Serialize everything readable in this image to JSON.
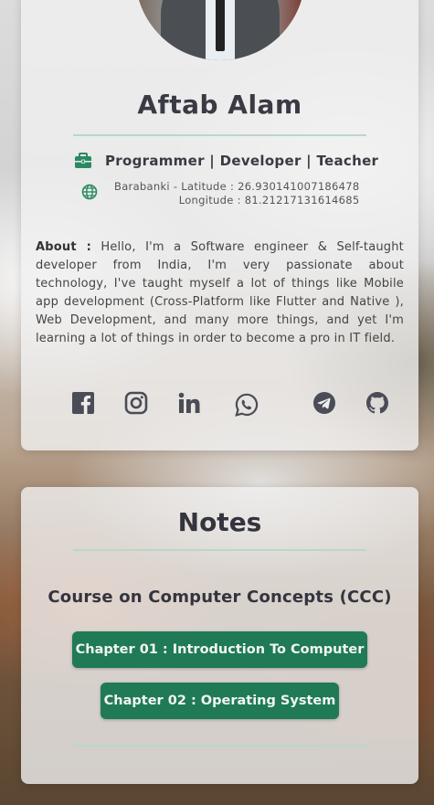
{
  "profile": {
    "name": "Aftab Alam",
    "role": "Programmer | Developer | Teacher",
    "location_line1": "Barabanki - Latitude : 26.930141007186478",
    "location_line2": "Longitude : 81.21217131614685",
    "about_label": "About :",
    "about_text": " Hello, I'm a Software engineer & Self-taught developer from India, I'm very passionate about technology, I've taught myself a lot of things like Mobile app development (Cross-Platform like Flutter and Native ), Web Development, and many more things, and yet I'm learning a lot of things in order to become a pro in IT field.",
    "icons": {
      "role": "briefcase-icon",
      "location": "globe-icon"
    },
    "socials": [
      "facebook-icon",
      "instagram-icon",
      "linkedin-icon",
      "whatsapp-icon",
      "telegram-icon",
      "github-icon"
    ]
  },
  "notes": {
    "title": "Notes",
    "course": "Course on Computer Concepts (CCC)",
    "chapters": [
      {
        "label": "Chapter 01 : Introduction To Computer"
      },
      {
        "label": "Chapter 02 : Operating System"
      }
    ]
  },
  "colors": {
    "accent": "#1f7a55",
    "divider": "#b8d8c8",
    "text_dark": "#3a3a44"
  }
}
